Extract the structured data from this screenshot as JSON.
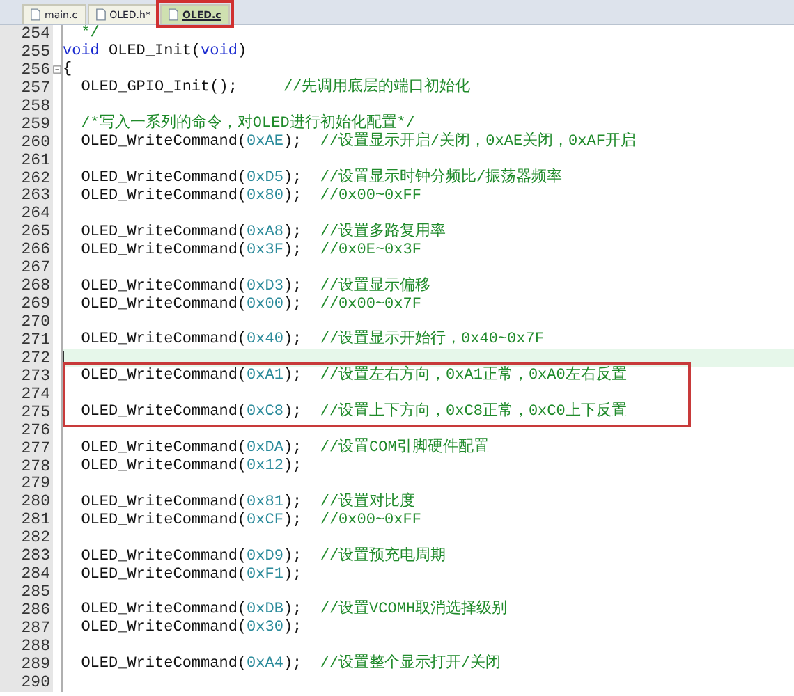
{
  "tabs": [
    {
      "label": "main.c",
      "selected": false,
      "boxed": false
    },
    {
      "label": "OLED.h*",
      "selected": false,
      "boxed": false
    },
    {
      "label": "OLED.c",
      "selected": true,
      "boxed": true
    }
  ],
  "lines": [
    {
      "number": "254",
      "parts": [
        {
          "kind": "comment",
          "text": "  */"
        }
      ]
    },
    {
      "number": "255",
      "parts": [
        {
          "kind": "keyword",
          "text": "void"
        },
        {
          "kind": "code",
          "text": " OLED_Init("
        },
        {
          "kind": "keyword",
          "text": "void"
        },
        {
          "kind": "code",
          "text": ")"
        }
      ]
    },
    {
      "number": "256",
      "fold": true,
      "parts": [
        {
          "kind": "code",
          "text": "{"
        }
      ]
    },
    {
      "number": "257",
      "parts": [
        {
          "kind": "code",
          "text": "  OLED_GPIO_Init();     "
        },
        {
          "kind": "comment",
          "text": "//先调用底层的端口初始化"
        }
      ]
    },
    {
      "number": "258"
    },
    {
      "number": "259",
      "parts": [
        {
          "kind": "comment",
          "text": "  /*写入一系列的命令，对OLED进行初始化配置*/"
        }
      ]
    },
    {
      "number": "260",
      "parts": [
        {
          "kind": "code",
          "text": "  OLED_WriteCommand("
        },
        {
          "kind": "number",
          "text": "0xAE"
        },
        {
          "kind": "code",
          "text": ");  "
        },
        {
          "kind": "comment",
          "text": "//设置显示开启/关闭，0xAE关闭，0xAF开启"
        }
      ]
    },
    {
      "number": "261"
    },
    {
      "number": "262",
      "parts": [
        {
          "kind": "code",
          "text": "  OLED_WriteCommand("
        },
        {
          "kind": "number",
          "text": "0xD5"
        },
        {
          "kind": "code",
          "text": ");  "
        },
        {
          "kind": "comment",
          "text": "//设置显示时钟分频比/振荡器频率"
        }
      ]
    },
    {
      "number": "263",
      "parts": [
        {
          "kind": "code",
          "text": "  OLED_WriteCommand("
        },
        {
          "kind": "number",
          "text": "0x80"
        },
        {
          "kind": "code",
          "text": ");  "
        },
        {
          "kind": "comment",
          "text": "//0x00~0xFF"
        }
      ]
    },
    {
      "number": "264"
    },
    {
      "number": "265",
      "parts": [
        {
          "kind": "code",
          "text": "  OLED_WriteCommand("
        },
        {
          "kind": "number",
          "text": "0xA8"
        },
        {
          "kind": "code",
          "text": ");  "
        },
        {
          "kind": "comment",
          "text": "//设置多路复用率"
        }
      ]
    },
    {
      "number": "266",
      "parts": [
        {
          "kind": "code",
          "text": "  OLED_WriteCommand("
        },
        {
          "kind": "number",
          "text": "0x3F"
        },
        {
          "kind": "code",
          "text": ");  "
        },
        {
          "kind": "comment",
          "text": "//0x0E~0x3F"
        }
      ]
    },
    {
      "number": "267"
    },
    {
      "number": "268",
      "parts": [
        {
          "kind": "code",
          "text": "  OLED_WriteCommand("
        },
        {
          "kind": "number",
          "text": "0xD3"
        },
        {
          "kind": "code",
          "text": ");  "
        },
        {
          "kind": "comment",
          "text": "//设置显示偏移"
        }
      ]
    },
    {
      "number": "269",
      "parts": [
        {
          "kind": "code",
          "text": "  OLED_WriteCommand("
        },
        {
          "kind": "number",
          "text": "0x00"
        },
        {
          "kind": "code",
          "text": ");  "
        },
        {
          "kind": "comment",
          "text": "//0x00~0x7F"
        }
      ]
    },
    {
      "number": "270"
    },
    {
      "number": "271",
      "parts": [
        {
          "kind": "code",
          "text": "  OLED_WriteCommand("
        },
        {
          "kind": "number",
          "text": "0x40"
        },
        {
          "kind": "code",
          "text": ");  "
        },
        {
          "kind": "comment",
          "text": "//设置显示开始行，0x40~0x7F"
        }
      ]
    },
    {
      "number": "272",
      "current": true
    },
    {
      "number": "273",
      "boxed": true,
      "parts": [
        {
          "kind": "code",
          "text": "  OLED_WriteCommand("
        },
        {
          "kind": "number",
          "text": "0xA1"
        },
        {
          "kind": "code",
          "text": ");  "
        },
        {
          "kind": "comment",
          "text": "//设置左右方向，0xA1正常，0xA0左右反置"
        }
      ]
    },
    {
      "number": "274",
      "boxed": true
    },
    {
      "number": "275",
      "boxed": true,
      "parts": [
        {
          "kind": "code",
          "text": "  OLED_WriteCommand("
        },
        {
          "kind": "number",
          "text": "0xC8"
        },
        {
          "kind": "code",
          "text": ");  "
        },
        {
          "kind": "comment",
          "text": "//设置上下方向，0xC8正常，0xC0上下反置"
        }
      ]
    },
    {
      "number": "276"
    },
    {
      "number": "277",
      "parts": [
        {
          "kind": "code",
          "text": "  OLED_WriteCommand("
        },
        {
          "kind": "number",
          "text": "0xDA"
        },
        {
          "kind": "code",
          "text": ");  "
        },
        {
          "kind": "comment",
          "text": "//设置COM引脚硬件配置"
        }
      ]
    },
    {
      "number": "278",
      "parts": [
        {
          "kind": "code",
          "text": "  OLED_WriteCommand("
        },
        {
          "kind": "number",
          "text": "0x12"
        },
        {
          "kind": "code",
          "text": ");"
        }
      ]
    },
    {
      "number": "279"
    },
    {
      "number": "280",
      "parts": [
        {
          "kind": "code",
          "text": "  OLED_WriteCommand("
        },
        {
          "kind": "number",
          "text": "0x81"
        },
        {
          "kind": "code",
          "text": ");  "
        },
        {
          "kind": "comment",
          "text": "//设置对比度"
        }
      ]
    },
    {
      "number": "281",
      "parts": [
        {
          "kind": "code",
          "text": "  OLED_WriteCommand("
        },
        {
          "kind": "number",
          "text": "0xCF"
        },
        {
          "kind": "code",
          "text": ");  "
        },
        {
          "kind": "comment",
          "text": "//0x00~0xFF"
        }
      ]
    },
    {
      "number": "282"
    },
    {
      "number": "283",
      "parts": [
        {
          "kind": "code",
          "text": "  OLED_WriteCommand("
        },
        {
          "kind": "number",
          "text": "0xD9"
        },
        {
          "kind": "code",
          "text": ");  "
        },
        {
          "kind": "comment",
          "text": "//设置预充电周期"
        }
      ]
    },
    {
      "number": "284",
      "parts": [
        {
          "kind": "code",
          "text": "  OLED_WriteCommand("
        },
        {
          "kind": "number",
          "text": "0xF1"
        },
        {
          "kind": "code",
          "text": ");"
        }
      ]
    },
    {
      "number": "285"
    },
    {
      "number": "286",
      "parts": [
        {
          "kind": "code",
          "text": "  OLED_WriteCommand("
        },
        {
          "kind": "number",
          "text": "0xDB"
        },
        {
          "kind": "code",
          "text": ");  "
        },
        {
          "kind": "comment",
          "text": "//设置VCOMH取消选择级别"
        }
      ]
    },
    {
      "number": "287",
      "parts": [
        {
          "kind": "code",
          "text": "  OLED_WriteCommand("
        },
        {
          "kind": "number",
          "text": "0x30"
        },
        {
          "kind": "code",
          "text": ");"
        }
      ]
    },
    {
      "number": "288"
    },
    {
      "number": "289",
      "parts": [
        {
          "kind": "code",
          "text": "  OLED_WriteCommand("
        },
        {
          "kind": "number",
          "text": "0xA4"
        },
        {
          "kind": "code",
          "text": ");  "
        },
        {
          "kind": "comment",
          "text": "//设置整个显示打开/关闭"
        }
      ]
    },
    {
      "number": "290"
    }
  ]
}
